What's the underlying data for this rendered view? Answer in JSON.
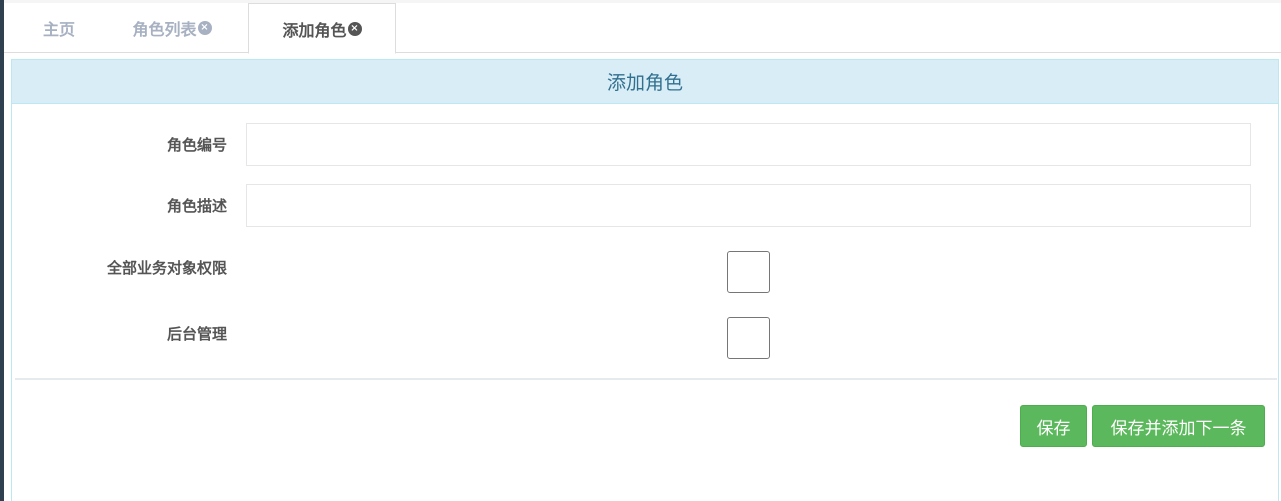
{
  "tabs": {
    "home": {
      "label": "主页"
    },
    "role_list": {
      "label": "角色列表",
      "close": "×"
    },
    "add_role": {
      "label": "添加角色",
      "close": "×"
    }
  },
  "panel": {
    "title": "添加角色"
  },
  "form": {
    "role_code": {
      "label": "角色编号",
      "value": ""
    },
    "role_desc": {
      "label": "角色描述",
      "value": ""
    },
    "all_business_perm": {
      "label": "全部业务对象权限",
      "checked": false
    },
    "backend_admin": {
      "label": "后台管理",
      "checked": false
    }
  },
  "buttons": {
    "save": "保存",
    "save_and_add_next": "保存并添加下一条"
  },
  "colors": {
    "panel_heading_bg": "#d9edf7",
    "panel_heading_text": "#31708f",
    "button_green": "#5cb85c",
    "left_edge": "#2f4050"
  }
}
